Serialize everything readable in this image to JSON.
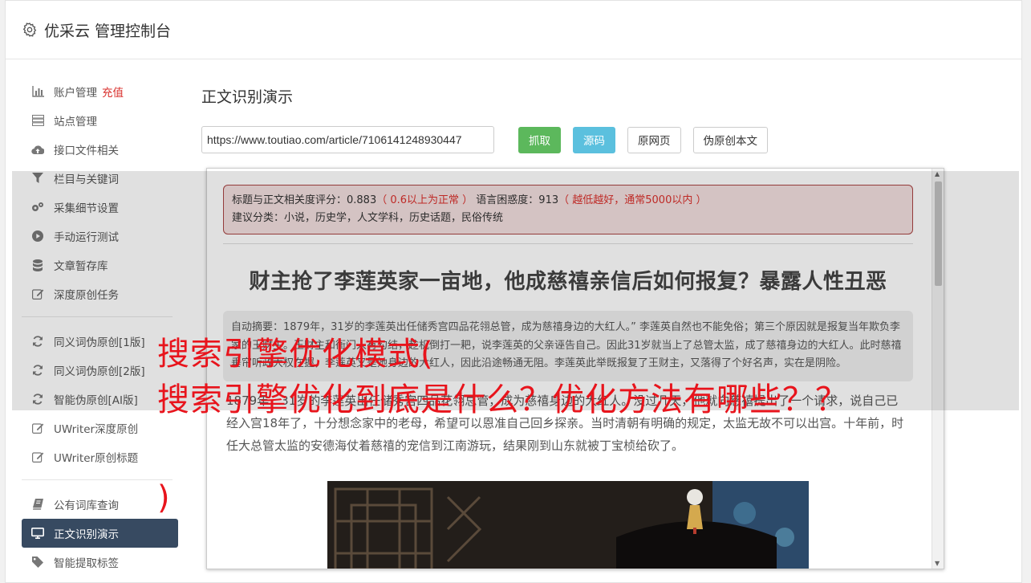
{
  "header": {
    "title": "优采云 管理控制台",
    "icon": "gear-icon"
  },
  "sidebar": {
    "groups": [
      [
        {
          "label": "账户管理",
          "badge": "充值",
          "icon": "bar-chart-icon"
        },
        {
          "label": "站点管理",
          "icon": "server-icon"
        },
        {
          "label": "接口文件相关",
          "icon": "cloud-upload-icon"
        },
        {
          "label": "栏目与关键词",
          "icon": "filter-icon"
        },
        {
          "label": "采集细节设置",
          "icon": "gears-icon"
        },
        {
          "label": "手动运行测试",
          "icon": "play-circle-icon"
        },
        {
          "label": "文章暂存库",
          "icon": "database-icon"
        },
        {
          "label": "深度原创任务",
          "icon": "edit-icon"
        }
      ],
      [
        {
          "label": "同义词伪原创[1版]",
          "icon": "refresh-icon"
        },
        {
          "label": "同义词伪原创[2版]",
          "icon": "refresh-icon"
        },
        {
          "label": "智能伪原创[AI版]",
          "icon": "refresh-icon"
        },
        {
          "label": "UWriter深度原创",
          "icon": "edit-icon"
        },
        {
          "label": "UWriter原创标题",
          "icon": "edit-icon"
        }
      ],
      [
        {
          "label": "公有词库查询",
          "icon": "book-icon"
        },
        {
          "label": "正文识别演示",
          "icon": "monitor-icon",
          "active": true
        },
        {
          "label": "智能提取标签",
          "icon": "tag-icon"
        }
      ]
    ]
  },
  "main": {
    "page_title": "正文识别演示",
    "url_value": "https://www.toutiao.com/article/7106141248930447",
    "buttons": {
      "fetch": "抓取",
      "source": "源码",
      "original": "原网页",
      "pseudo": "伪原创本文"
    },
    "analysis": {
      "line1_label": "标题与正文相关度评分：0.883",
      "line1_hint": "（ 0.6以上为正常 ）",
      "line1_label2": " 语言困惑度：913",
      "line1_hint2": "（ 越低越好，通常5000以内 ）",
      "line2": "建议分类：小说，历史学，人文学科，历史话题，民俗传统"
    },
    "article": {
      "title": "财主抢了李莲英家一亩地，他成慈禧亲信后如何报复？暴露人性丑恶",
      "summary": "自动摘要：1879年，31岁的李莲英出任储秀宫四品花翎总管，成为慈禧身边的大红人。” 李莲英自然也不能免俗；第三个原因就是报复当年欺负李家的王财主。王财主和衙门人有勾结，趁机倒打一耙，说李莲英的父亲诬告自己。因此31岁就当上了总管太监，成了慈禧身边的大红人。此时慈禧垂帘听政大权在握，李莲英又是她身边的大红人，因此沿途畅通无阻。李莲英此举既报复了王财主，又落得了个好名声，实在是阴险。",
      "paragraph": "1879年，31岁的李莲英出任储秀宫四品花翎总管，成为慈禧身边的大红人。没过几天，他就向慈禧提出了一个请求，说自己已经入宫18年了，十分想念家中的老母，希望可以恩准自己回乡探亲。当时清朝有明确的规定，太监无故不可以出宫。十年前，时任大总管太监的安德海仗着慈禧的宠信到江南游玩，结果刚到山东就被丁宝桢给砍了。"
    }
  },
  "overlay": {
    "line1": "搜索引擎优化模式(",
    "line2": "搜索引擎优化到底是什么？优化方法有哪些？？",
    "line3": ")"
  },
  "colors": {
    "accent_active": "#374a61",
    "green": "#5cb85c",
    "blue": "#5bc0de",
    "red": "#e8141c"
  }
}
